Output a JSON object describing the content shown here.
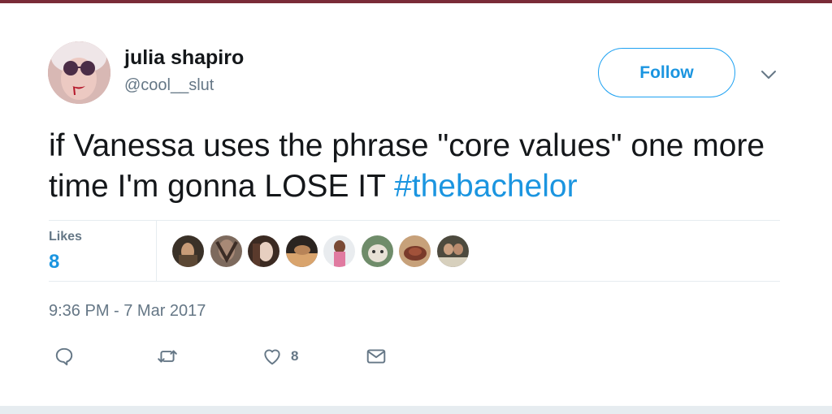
{
  "tweet": {
    "author_name": "julia shapiro",
    "author_handle": "@cool__slut",
    "follow_label": "Follow",
    "text_main": "if Vanessa uses the phrase \"core values\" one more time I'm gonna LOSE IT ",
    "hashtag": "#thebachelor",
    "likes_label": "Likes",
    "likes_count": "8",
    "timestamp": "9:36 PM - 7 Mar 2017",
    "action_like_count": "8"
  },
  "colors": {
    "accent": "#1b95e0",
    "muted_text": "#657786",
    "divider": "#e6ecf0"
  },
  "icons": [
    "chevron-down-icon",
    "reply-icon",
    "retweet-icon",
    "heart-icon",
    "envelope-icon"
  ]
}
